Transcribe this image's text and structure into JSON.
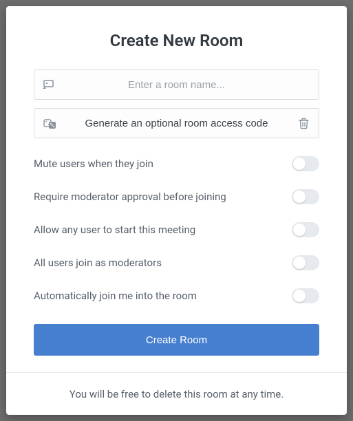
{
  "modal": {
    "title": "Create New Room",
    "room_name": {
      "value": "",
      "placeholder": "Enter a room name..."
    },
    "access_code": {
      "label": "Generate an optional room access code"
    },
    "options": [
      {
        "label": "Mute users when they join",
        "enabled": false
      },
      {
        "label": "Require moderator approval before joining",
        "enabled": false
      },
      {
        "label": "Allow any user to start this meeting",
        "enabled": false
      },
      {
        "label": "All users join as moderators",
        "enabled": false
      },
      {
        "label": "Automatically join me into the room",
        "enabled": false
      }
    ],
    "create_button": "Create Room",
    "footer_text": "You will be free to delete this room at any time."
  },
  "icons": {
    "room": "room-icon",
    "dice": "dice-icon",
    "trash": "trash-icon"
  },
  "colors": {
    "primary": "#467fcf",
    "text": "#57606a",
    "border": "#d7dbe0",
    "toggle_off": "#e6e9ed"
  }
}
